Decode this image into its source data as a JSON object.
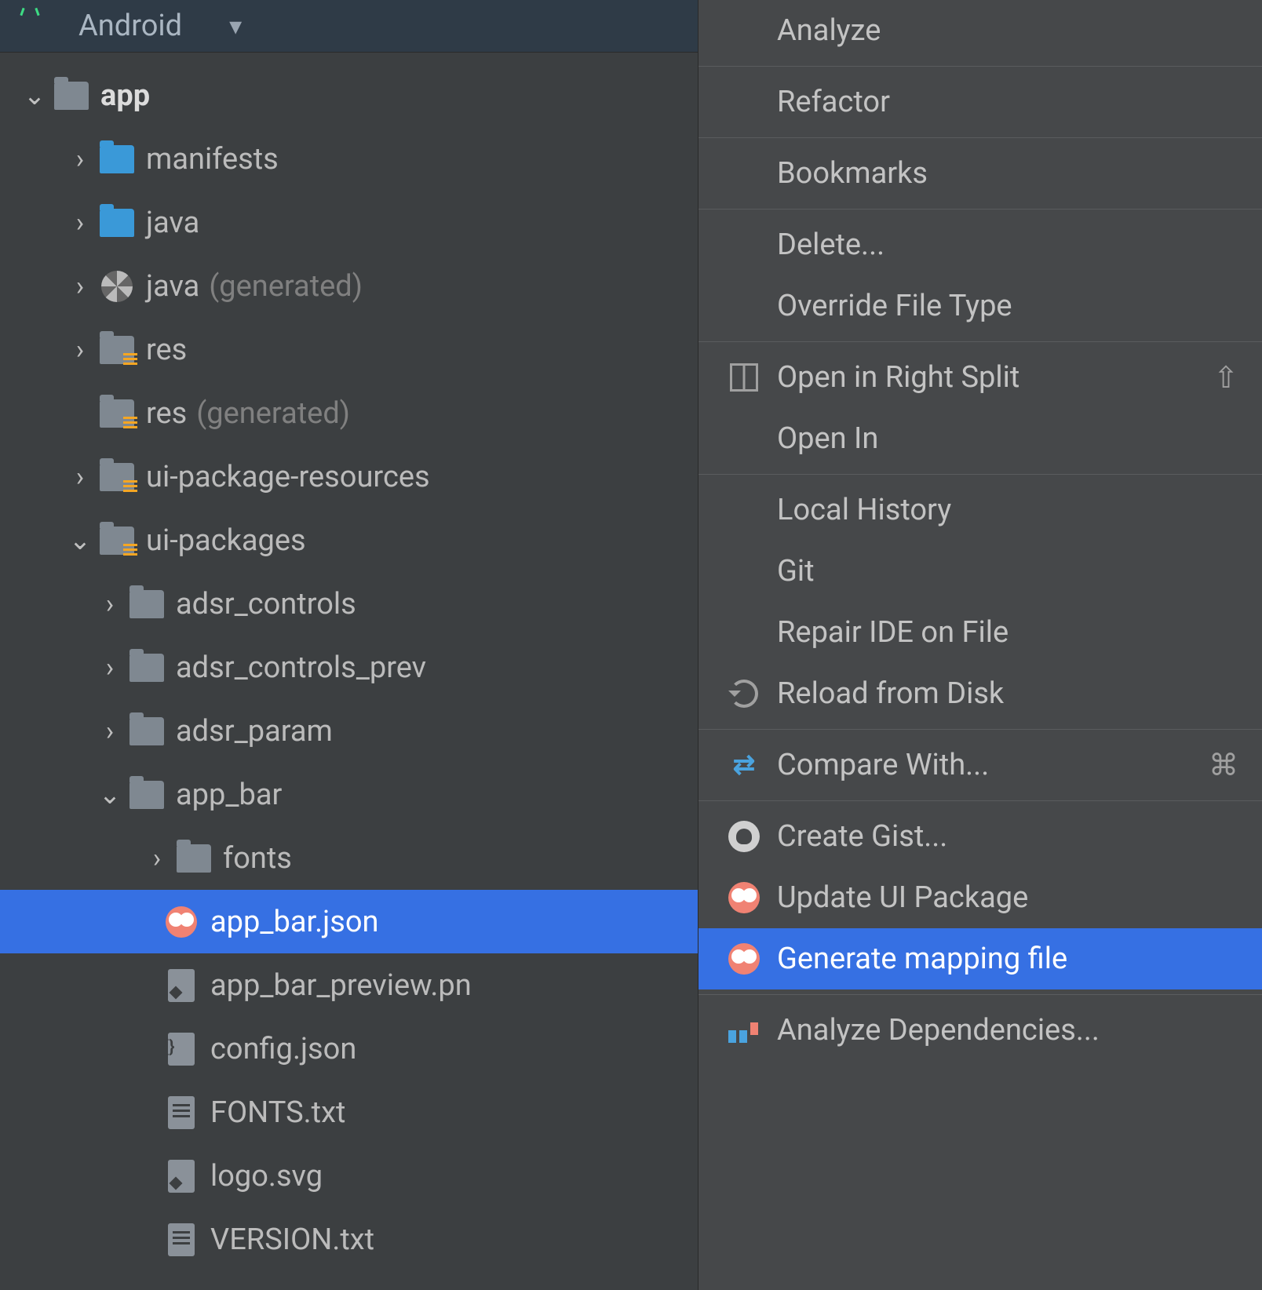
{
  "view": {
    "label": "Android"
  },
  "tree": {
    "app": {
      "label": "app"
    },
    "manifests": {
      "label": "manifests"
    },
    "java": {
      "label": "java"
    },
    "java_gen": {
      "label": "java",
      "suffix": "(generated)"
    },
    "res": {
      "label": "res"
    },
    "res_gen": {
      "label": "res",
      "suffix": "(generated)"
    },
    "ui_pkg_res": {
      "label": "ui-package-resources"
    },
    "ui_pkgs": {
      "label": "ui-packages"
    },
    "adsr_controls": {
      "label": "adsr_controls"
    },
    "adsr_controls_prev": {
      "label": "adsr_controls_prev"
    },
    "adsr_param": {
      "label": "adsr_param"
    },
    "app_bar": {
      "label": "app_bar"
    },
    "fonts": {
      "label": "fonts"
    },
    "app_bar_json": {
      "label": "app_bar.json"
    },
    "app_bar_preview": {
      "label": "app_bar_preview.pn"
    },
    "config_json": {
      "label": "config.json"
    },
    "fonts_txt": {
      "label": "FONTS.txt"
    },
    "logo_svg": {
      "label": "logo.svg"
    },
    "version_txt": {
      "label": "VERSION.txt"
    }
  },
  "menu": {
    "analyze": "Analyze",
    "refactor": "Refactor",
    "bookmarks": "Bookmarks",
    "delete": "Delete...",
    "override_file_type": "Override File Type",
    "open_right_split": "Open in Right Split",
    "open_right_split_shortcut": "⇧",
    "open_in": "Open In",
    "local_history": "Local History",
    "git": "Git",
    "repair_ide": "Repair IDE on File",
    "reload_disk": "Reload from Disk",
    "compare_with": "Compare With...",
    "compare_with_shortcut": "⌘",
    "create_gist": "Create Gist...",
    "update_ui_pkg": "Update UI Package",
    "generate_mapping": "Generate mapping file",
    "analyze_deps": "Analyze Dependencies..."
  }
}
